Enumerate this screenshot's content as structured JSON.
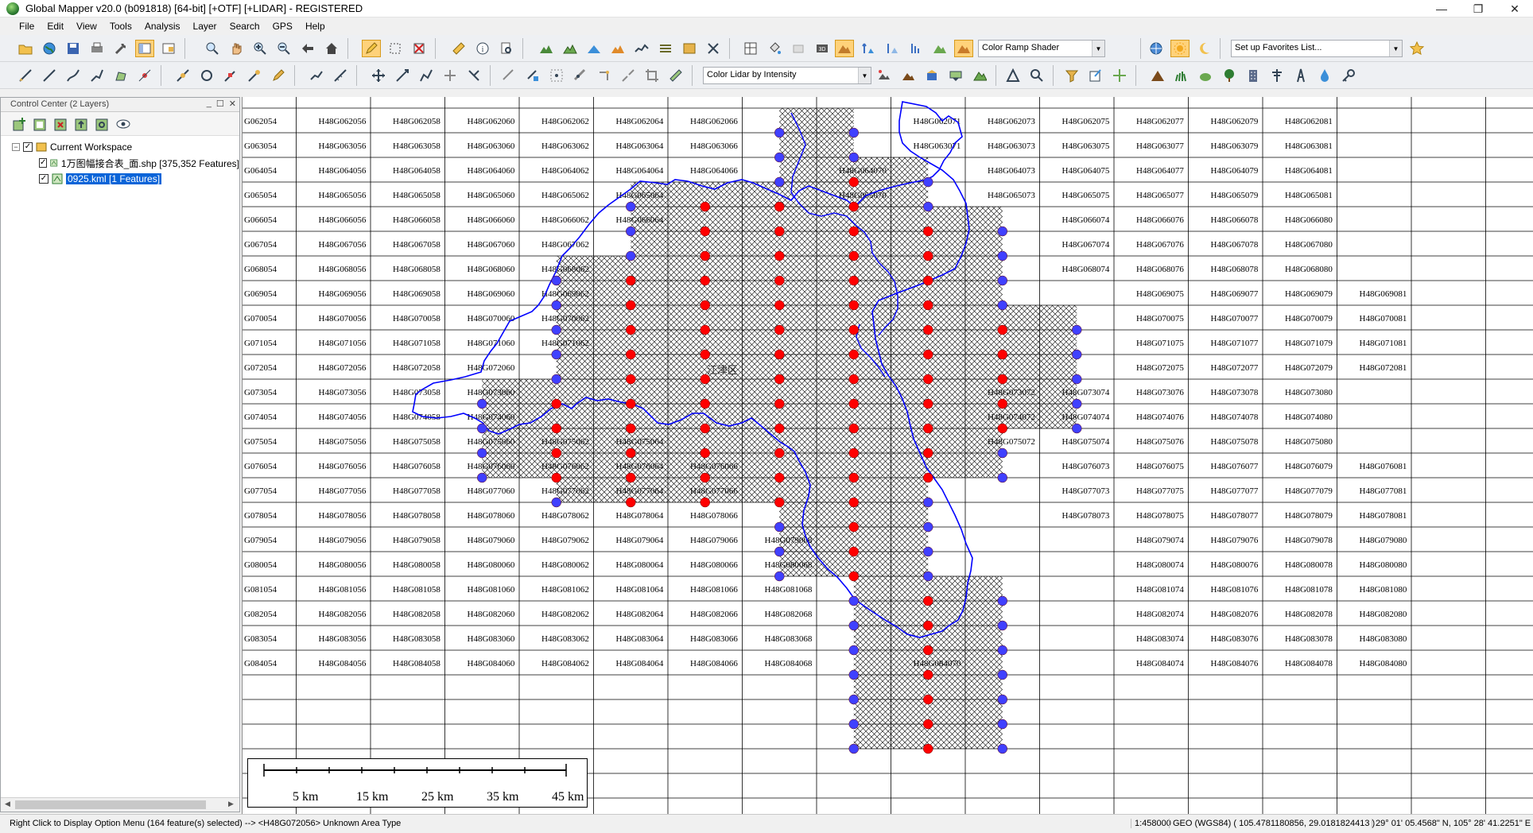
{
  "window": {
    "title": "Global Mapper v20.0 (b091818) [64-bit] [+OTF] [+LIDAR] - REGISTERED",
    "minimize": "—",
    "maximize": "❐",
    "close": "✕"
  },
  "menu": [
    "File",
    "Edit",
    "View",
    "Tools",
    "Analysis",
    "Layer",
    "Search",
    "GPS",
    "Help"
  ],
  "toolbar": {
    "shader_combo": "Color Ramp Shader",
    "favorites_combo": "Set up Favorites List...",
    "lidar_combo": "Color Lidar by Intensity"
  },
  "control_center": {
    "title": "Control Center (2 Layers)",
    "workspace": "Current Workspace",
    "layers": [
      {
        "name": "1万图幅接合表_面.shp [375,352 Features]",
        "checked": true,
        "selected": false
      },
      {
        "name": "0925.kml [1 Features]",
        "checked": true,
        "selected": true
      }
    ]
  },
  "map": {
    "center_label": "江津区",
    "cells": [
      [
        "G062054",
        "H48G062056",
        "H48G062058",
        "H48G062060",
        "H48G062062",
        "H48G062064",
        "H48G062066",
        "",
        "",
        "H48G062071",
        "H48G062073",
        "H48G062075",
        "H48G062077",
        "H48G062079",
        "H48G062081"
      ],
      [
        "G063054",
        "H48G063056",
        "H48G063058",
        "H48G063060",
        "H48G063062",
        "H48G063064",
        "H48G063066",
        "",
        "",
        "H48G063071",
        "H48G063073",
        "H48G063075",
        "H48G063077",
        "H48G063079",
        "H48G063081"
      ],
      [
        "G064054",
        "H48G064056",
        "H48G064058",
        "H48G064060",
        "H48G064062",
        "H48G064064",
        "H48G064066",
        "",
        "H48G064070",
        "",
        "H48G064073",
        "H48G064075",
        "H48G064077",
        "H48G064079",
        "H48G064081"
      ],
      [
        "G065054",
        "H48G065056",
        "H48G065058",
        "H48G065060",
        "H48G065062",
        "H48G065064",
        "",
        "",
        "H48G065070",
        "",
        "H48G065073",
        "H48G065075",
        "H48G065077",
        "H48G065079",
        "H48G065081"
      ],
      [
        "G066054",
        "H48G066056",
        "H48G066058",
        "H48G066060",
        "H48G066062",
        "H48G066064",
        "",
        "",
        "",
        "",
        "",
        "H48G066074",
        "H48G066076",
        "H48G066078",
        "H48G066080"
      ],
      [
        "G067054",
        "H48G067056",
        "H48G067058",
        "H48G067060",
        "H48G067062",
        "",
        "",
        "",
        "",
        "",
        "",
        "H48G067074",
        "H48G067076",
        "H48G067078",
        "H48G067080"
      ],
      [
        "G068054",
        "H48G068056",
        "H48G068058",
        "H48G068060",
        "H48G068062",
        "",
        "",
        "",
        "",
        "",
        "",
        "H48G068074",
        "H48G068076",
        "H48G068078",
        "H48G068080"
      ],
      [
        "G069054",
        "H48G069056",
        "H48G069058",
        "H48G069060",
        "H48G069062",
        "",
        "",
        "",
        "",
        "",
        "",
        "",
        "H48G069075",
        "H48G069077",
        "H48G069079",
        "H48G069081"
      ],
      [
        "G070054",
        "H48G070056",
        "H48G070058",
        "H48G070060",
        "H48G070062",
        "",
        "",
        "",
        "",
        "",
        "",
        "",
        "H48G070075",
        "H48G070077",
        "H48G070079",
        "H48G070081"
      ],
      [
        "G071054",
        "H48G071056",
        "H48G071058",
        "H48G071060",
        "H48G071062",
        "",
        "",
        "",
        "",
        "",
        "",
        "",
        "H48G071075",
        "H48G071077",
        "H48G071079",
        "H48G071081"
      ],
      [
        "G072054",
        "H48G072056",
        "H48G072058",
        "H48G072060",
        "",
        "",
        "",
        "",
        "",
        "",
        "",
        "",
        "H48G072075",
        "H48G072077",
        "H48G072079",
        "H48G072081"
      ],
      [
        "G073054",
        "H48G073056",
        "H48G073058",
        "H48G073060",
        "",
        "",
        "",
        "",
        "",
        "",
        "H48G073072",
        "H48G073074",
        "H48G073076",
        "H48G073078",
        "H48G073080"
      ],
      [
        "G074054",
        "H48G074056",
        "H48G074058",
        "H48G074060",
        "",
        "",
        "",
        "",
        "",
        "",
        "H48G074072",
        "H48G074074",
        "H48G074076",
        "H48G074078",
        "H48G074080"
      ],
      [
        "G075054",
        "H48G075056",
        "H48G075058",
        "H48G075060",
        "H48G075062",
        "H48G075064",
        "",
        "",
        "",
        "",
        "H48G075072",
        "H48G075074",
        "H48G075076",
        "H48G075078",
        "H48G075080"
      ],
      [
        "G076054",
        "H48G076056",
        "H48G076058",
        "H48G076060",
        "H48G076062",
        "H48G076064",
        "H48G076066",
        "",
        "",
        "",
        "",
        "H48G076073",
        "H48G076075",
        "H48G076077",
        "H48G076079",
        "H48G076081"
      ],
      [
        "G077054",
        "H48G077056",
        "H48G077058",
        "H48G077060",
        "H48G077062",
        "H48G077064",
        "H48G077066",
        "",
        "",
        "",
        "",
        "H48G077073",
        "H48G077075",
        "H48G077077",
        "H48G077079",
        "H48G077081"
      ],
      [
        "G078054",
        "H48G078056",
        "H48G078058",
        "H48G078060",
        "H48G078062",
        "H48G078064",
        "H48G078066",
        "",
        "",
        "",
        "",
        "H48G078073",
        "H48G078075",
        "H48G078077",
        "H48G078079",
        "H48G078081"
      ],
      [
        "G079054",
        "H48G079056",
        "H48G079058",
        "H48G079060",
        "H48G079062",
        "H48G079064",
        "H48G079066",
        "H48G079068",
        "",
        "",
        "",
        "",
        "H48G079074",
        "H48G079076",
        "H48G079078",
        "H48G079080"
      ],
      [
        "G080054",
        "H48G080056",
        "H48G080058",
        "H48G080060",
        "H48G080062",
        "H48G080064",
        "H48G080066",
        "H48G080068",
        "",
        "",
        "",
        "",
        "H48G080074",
        "H48G080076",
        "H48G080078",
        "H48G080080"
      ],
      [
        "G081054",
        "H48G081056",
        "H48G081058",
        "H48G081060",
        "H48G081062",
        "H48G081064",
        "H48G081066",
        "H48G081068",
        "",
        "",
        "",
        "",
        "H48G081074",
        "H48G081076",
        "H48G081078",
        "H48G081080"
      ],
      [
        "G082054",
        "H48G082056",
        "H48G082058",
        "H48G082060",
        "H48G082062",
        "H48G082064",
        "H48G082066",
        "H48G082068",
        "",
        "",
        "",
        "",
        "H48G082074",
        "H48G082076",
        "H48G082078",
        "H48G082080"
      ],
      [
        "G083054",
        "H48G083056",
        "H48G083058",
        "H48G083060",
        "H48G083062",
        "H48G083064",
        "H48G083066",
        "H48G083068",
        "",
        "",
        "",
        "",
        "H48G083074",
        "H48G083076",
        "H48G083078",
        "H48G083080"
      ],
      [
        "G084054",
        "H48G084056",
        "H48G084058",
        "H48G084060",
        "H48G084062",
        "H48G084064",
        "H48G084066",
        "H48G084068",
        "",
        "H48G084070",
        "",
        "",
        "H48G084074",
        "H48G084076",
        "H48G084078",
        "H48G084080"
      ]
    ],
    "scale_labels": [
      "5 km",
      "15 km",
      "25 km",
      "35 km",
      "45 km"
    ],
    "colors": {
      "grid": "#000000",
      "hatch": "#000000",
      "boundary": "#0000ff",
      "point_inside": "#ff0000",
      "point_edge": "#4040ff"
    }
  },
  "status": {
    "message": "Right Click to Display Option Menu (164 feature(s) selected) --> <H48G072056> Unknown Area Type",
    "scale": "1:458000",
    "coords": "GEO (WGS84) ( 105.4781180856, 29.0181824413 )",
    "dms": "29° 01' 05.4568\" N, 105° 28' 41.2251\" E"
  }
}
